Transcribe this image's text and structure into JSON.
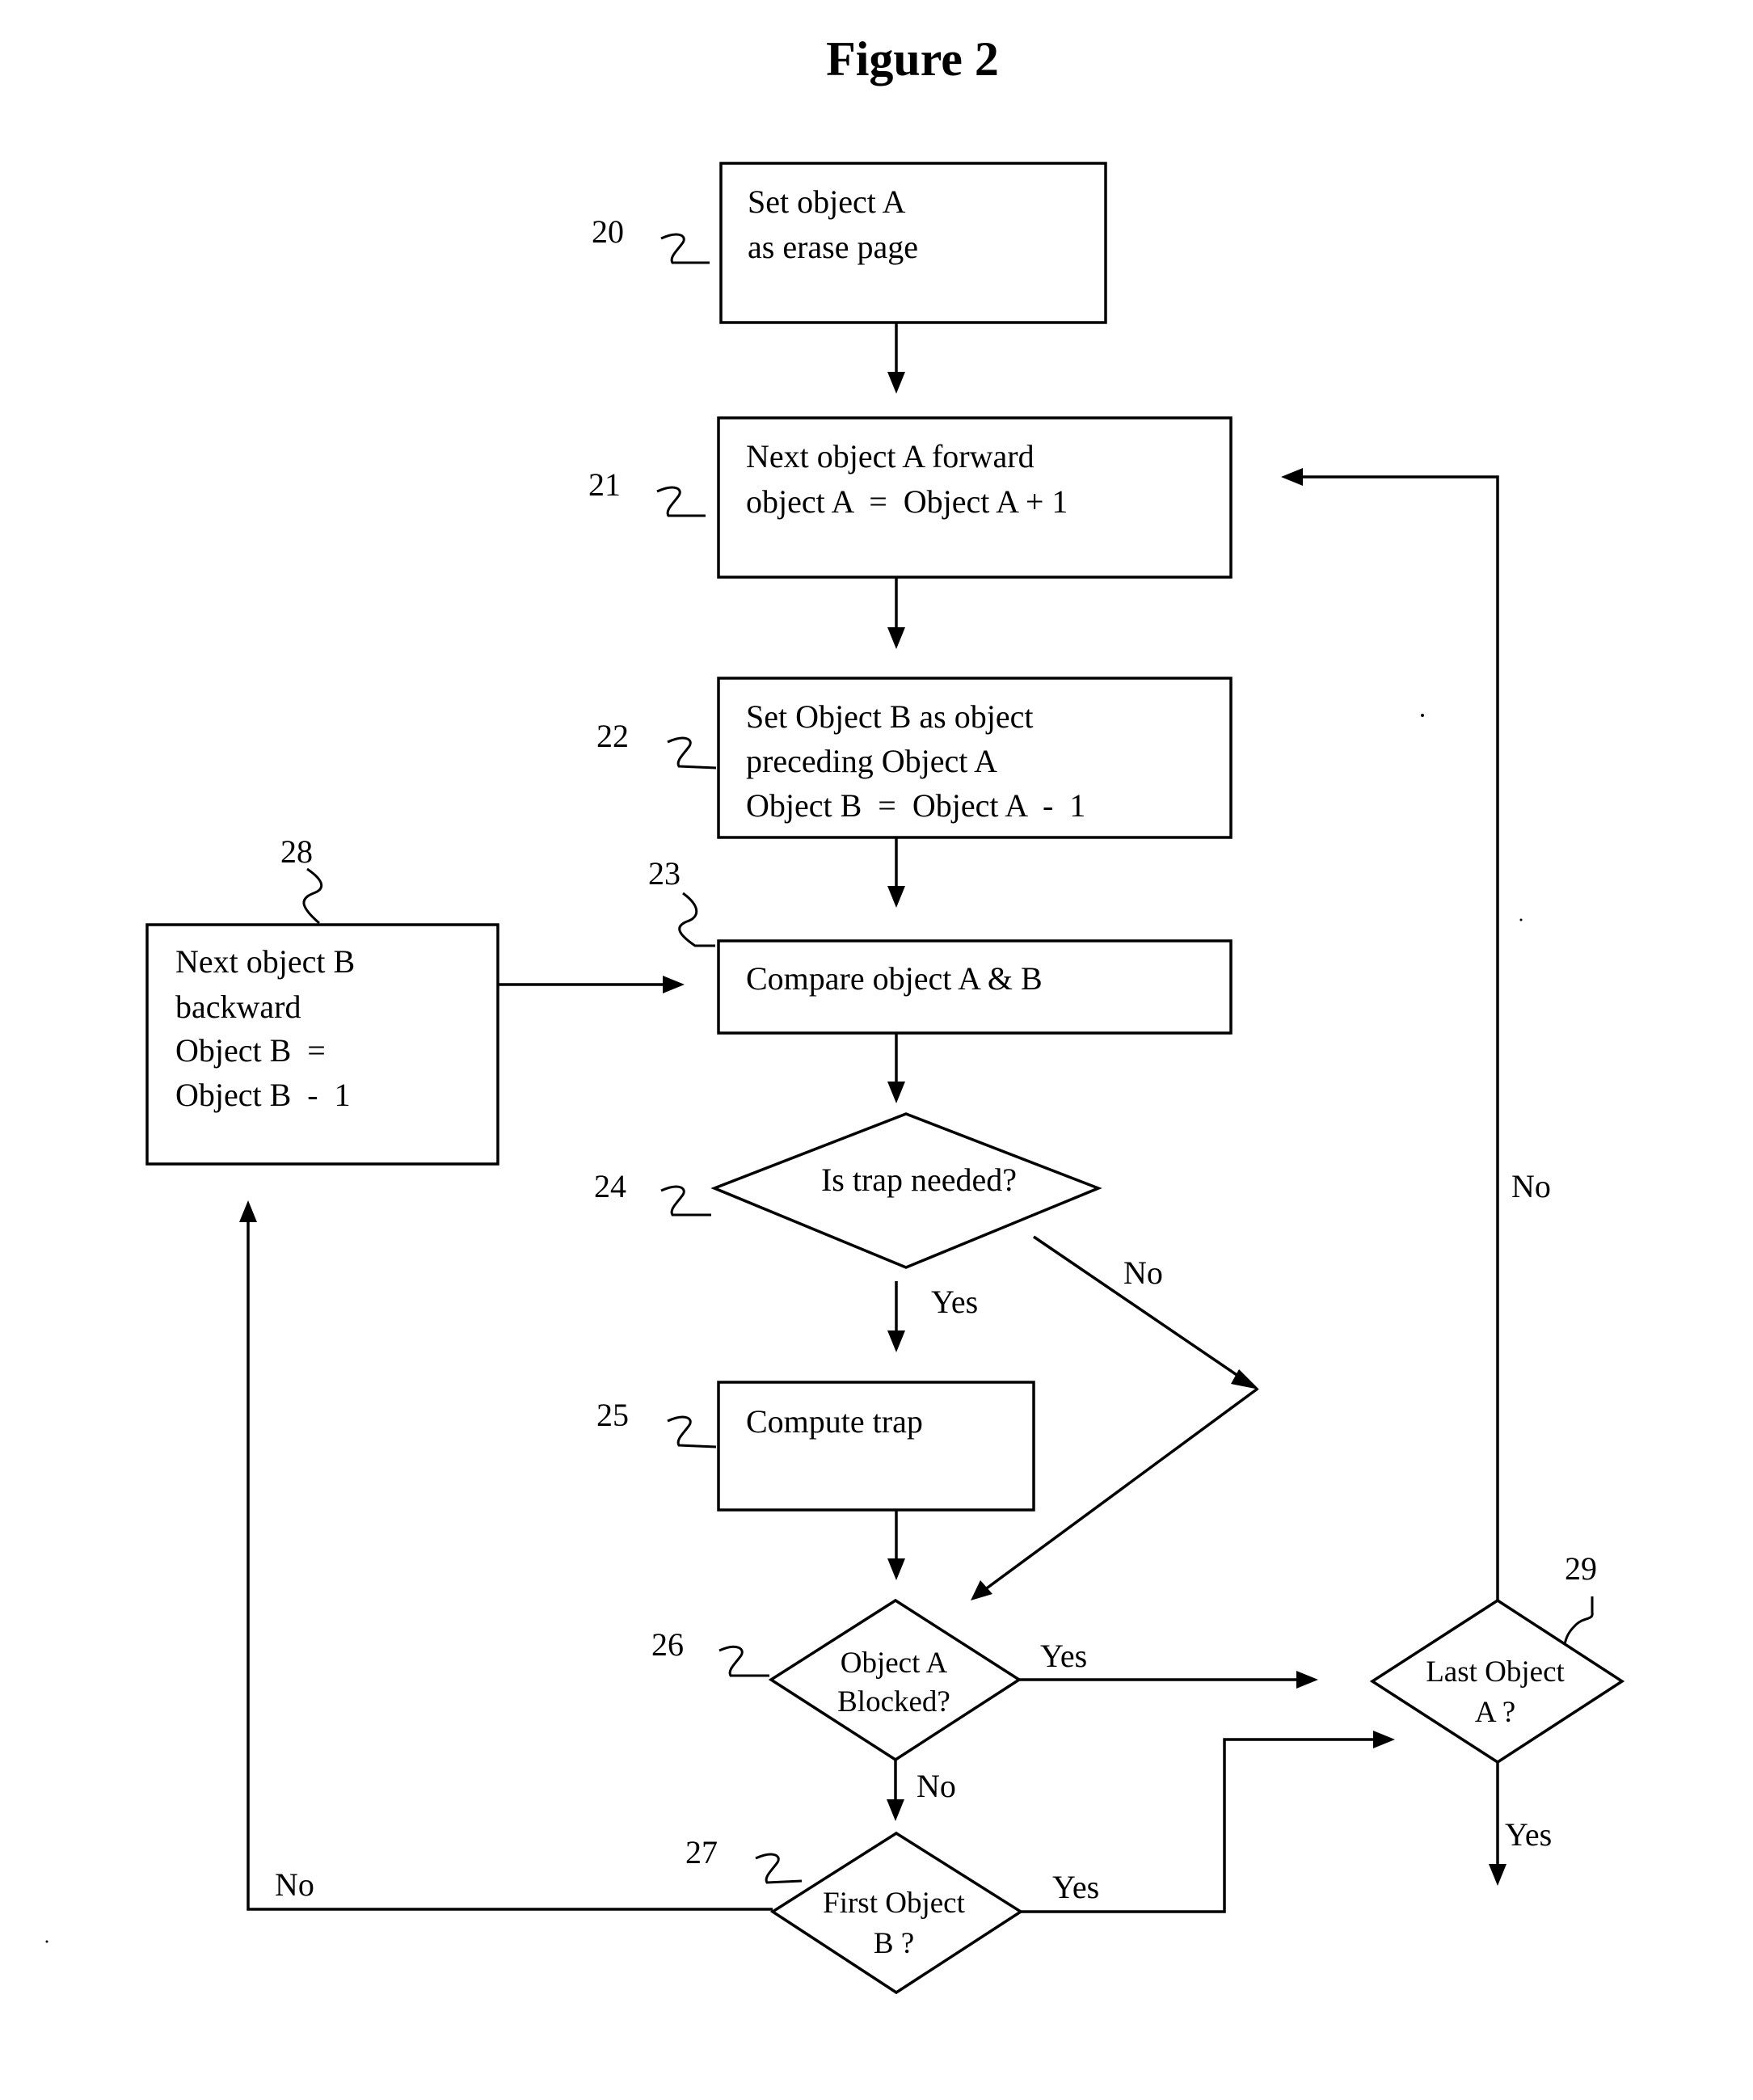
{
  "figure": {
    "title": "Figure 2"
  },
  "nodes": {
    "n20": {
      "ref": "20",
      "type": "process",
      "lines": [
        "Set object A",
        "as erase page"
      ]
    },
    "n21": {
      "ref": "21",
      "type": "process",
      "lines": [
        "Next object A forward",
        "object A  =  Object A + 1"
      ]
    },
    "n22": {
      "ref": "22",
      "type": "process",
      "lines": [
        "Set Object B as object",
        "preceding Object A",
        "Object B  =  Object A  -  1"
      ]
    },
    "n23": {
      "ref": "23",
      "type": "process",
      "lines": [
        "Compare object A & B"
      ]
    },
    "n24": {
      "ref": "24",
      "type": "decision",
      "lines": [
        "Is trap needed?"
      ]
    },
    "n25": {
      "ref": "25",
      "type": "process",
      "lines": [
        "Compute trap"
      ]
    },
    "n26": {
      "ref": "26",
      "type": "decision",
      "lines": [
        "Object A",
        "Blocked?"
      ]
    },
    "n27": {
      "ref": "27",
      "type": "decision",
      "lines": [
        "First Object",
        "B ?"
      ]
    },
    "n28": {
      "ref": "28",
      "type": "process",
      "lines": [
        "Next object B",
        "backward",
        "Object B  =",
        "Object B  -  1"
      ]
    },
    "n29": {
      "ref": "29",
      "type": "decision",
      "lines": [
        "Last Object",
        "A ?"
      ]
    }
  },
  "edges": {
    "e24_yes": {
      "from": "24",
      "to": "25",
      "label": "Yes"
    },
    "e24_no": {
      "from": "24",
      "to": "26",
      "label": "No"
    },
    "e26_yes": {
      "from": "26",
      "to": "29",
      "label": "Yes"
    },
    "e26_no": {
      "from": "26",
      "to": "27",
      "label": "No"
    },
    "e27_yes": {
      "from": "27",
      "to": "29",
      "label": "Yes"
    },
    "e27_no": {
      "from": "27",
      "to": "28",
      "label": "No"
    },
    "e29_no": {
      "from": "29",
      "to": "21",
      "label": "No"
    },
    "e29_yes": {
      "from": "29",
      "to": "end",
      "label": "Yes"
    }
  }
}
